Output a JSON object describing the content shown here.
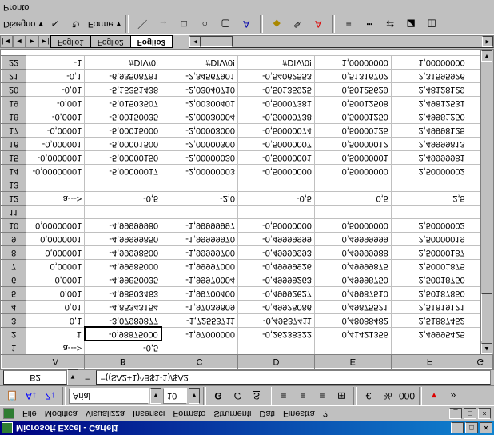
{
  "window": {
    "app_icon": "excel-icon",
    "title": "Microsoft Excel - Cartel1",
    "min": "_",
    "max": "□",
    "close": "×"
  },
  "menubar": {
    "items": [
      "File",
      "Modifica",
      "Visualizza",
      "Inserisci",
      "Formato",
      "Strumenti",
      "Dati",
      "Finestra",
      "?"
    ]
  },
  "format_toolbar": {
    "font": "Arial",
    "size": "10",
    "bold": "G",
    "italic": "C",
    "underline": "S",
    "currency": "€",
    "percent": "%"
  },
  "formula_bar": {
    "cell_ref": "B2",
    "equals": "=",
    "formula": "=(($A2+1)^B$1-1)/$A2"
  },
  "columns": [
    "A",
    "B",
    "C",
    "D",
    "E",
    "F",
    "G"
  ],
  "rows": [
    {
      "n": "1",
      "cells": [
        "a--->",
        "-0,5",
        "",
        "",
        "",
        ""
      ]
    },
    {
      "n": "2",
      "cells": [
        "1",
        "-0,98875000",
        "-1,97000000",
        "-0,26238322",
        "0,41421356",
        "2,49995425"
      ]
    },
    {
      "n": "3",
      "cells": [
        "0,1",
        "-3,07989877",
        "-1,72553711",
        "-0,49537411",
        "0,48088482",
        "2,51887452"
      ]
    },
    {
      "n": "4",
      "cells": [
        "0,01",
        "-4,85343154",
        "-1,97039609",
        "-0,49928086",
        "0,49875521",
        "2,51819121"
      ]
    },
    {
      "n": "5",
      "cells": [
        "0,001",
        "-4,98503463",
        "-1,99700400",
        "-0,49992627",
        "0,49987510",
        "2,50187850"
      ]
    },
    {
      "n": "6",
      "cells": [
        "0,0001",
        "-4,99850035",
        "-1,99970004",
        "-0,49999263",
        "0,49998750",
        "2,50018750"
      ]
    },
    {
      "n": "7",
      "cells": [
        "0,00001",
        "-4,99985000",
        "-1,99997000",
        "-0,49999926",
        "0,49999875",
        "2,50001875"
      ]
    },
    {
      "n": "8",
      "cells": [
        "0,000001",
        "-4,99998500",
        "-1,99999700",
        "-0,49999993",
        "0,49999988",
        "2,50000187"
      ]
    },
    {
      "n": "9",
      "cells": [
        "0,0000001",
        "-4,99999850",
        "-1,99999970",
        "-0,49999999",
        "0,49999999",
        "2,50000019"
      ]
    },
    {
      "n": "10",
      "cells": [
        "0,00000001",
        "-4,99999980",
        "-1,99999997",
        "-0,50000000",
        "0,50000000",
        "2,50000002"
      ]
    },
    {
      "n": "11",
      "cells": [
        "",
        "",
        "",
        "",
        "",
        ""
      ]
    },
    {
      "n": "12",
      "cells": [
        "a--->",
        "-0,5",
        "-2,0",
        "-0,5",
        "0,5",
        "2,5"
      ]
    },
    {
      "n": "13",
      "cells": [
        "",
        "",
        "",
        "",
        "",
        ""
      ]
    },
    {
      "n": "14",
      "cells": [
        "-0,00000001",
        "-5,00000017",
        "-2,00000003",
        "-0,50000000",
        "0,50000000",
        "2,50000002"
      ]
    },
    {
      "n": "15",
      "cells": [
        "-0,0000001",
        "-5,00000150",
        "-2,00000030",
        "-0,50000001",
        "0,50000001",
        "2,49999981"
      ]
    },
    {
      "n": "16",
      "cells": [
        "-0,000001",
        "-5,00001500",
        "-2,00000300",
        "-0,50000007",
        "0,50000012",
        "2,49999813"
      ]
    },
    {
      "n": "17",
      "cells": [
        "-0,00001",
        "-5,00015000",
        "-2,00003000",
        "-0,50000074",
        "0,50000125",
        "2,49998125"
      ]
    },
    {
      "n": "18",
      "cells": [
        "-0,0001",
        "-5,00150035",
        "-2,00030004",
        "-0,50000738",
        "0,50001250",
        "2,49981250"
      ]
    },
    {
      "n": "19",
      "cells": [
        "-0,001",
        "-5,01503507",
        "-2,00300401",
        "-0,50007381",
        "0,50012508",
        "2,49812531"
      ]
    },
    {
      "n": "20",
      "cells": [
        "-0,01",
        "-5,15351438",
        "-2,03040710",
        "-0,50135925",
        "0,50125629",
        "2,48128129"
      ]
    },
    {
      "n": "21",
      "cells": [
        "-0,1",
        "-6,93508781",
        "-2,34567901",
        "-0,54062553",
        "0,51316702",
        "2,31595926"
      ]
    },
    {
      "n": "22",
      "cells": [
        "-1",
        "#DIV/0!",
        "#DIV/0!",
        "#DIV/0!",
        "1,00000000",
        "1,00000000"
      ]
    }
  ],
  "tabs": {
    "nav": [
      "|◄",
      "◄",
      "►",
      "►|"
    ],
    "sheets": [
      "Foglio1",
      "Foglio2",
      "Foglio3"
    ],
    "active": 2
  },
  "drawbar": {
    "label": "Disegno",
    "shapes": "Forme"
  },
  "status": "Pronto"
}
